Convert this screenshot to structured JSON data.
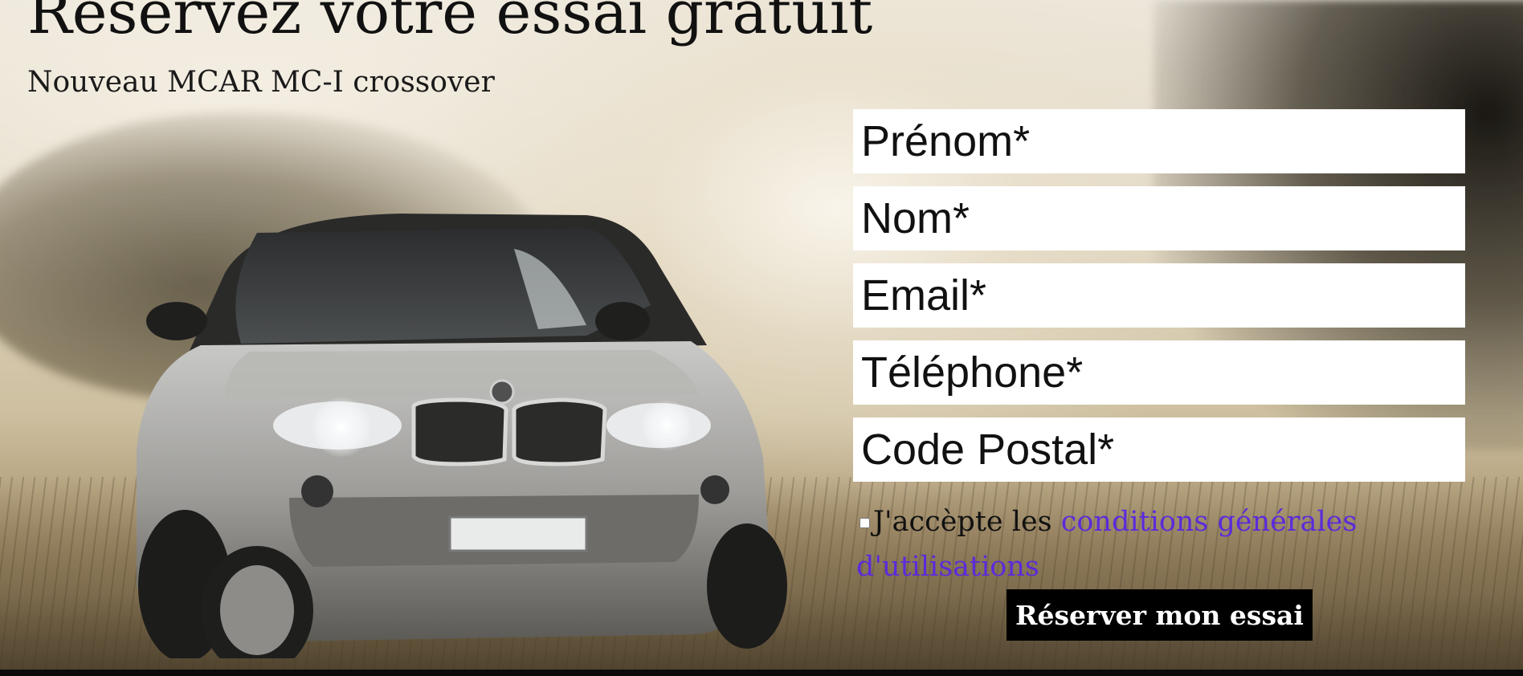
{
  "hero": {
    "title": "Réservez votre essai gratuit",
    "subtitle": "Nouveau MCAR MC-I crossover",
    "image_alt": "SUV"
  },
  "form": {
    "first_name_placeholder": "Prénom*",
    "last_name_placeholder": "Nom*",
    "email_placeholder": "Email*",
    "phone_placeholder": "Téléphone*",
    "postal_code_placeholder": "Code Postal*",
    "terms_prefix": "J'accèpte les ",
    "terms_link": "conditions générales d'utilisations",
    "submit_label": "Réserver mon essai",
    "terms_checked": false
  },
  "colors": {
    "link": "#5b2bdb",
    "button_bg": "#000000",
    "button_text": "#ffffff",
    "field_bg": "#ffffff"
  }
}
